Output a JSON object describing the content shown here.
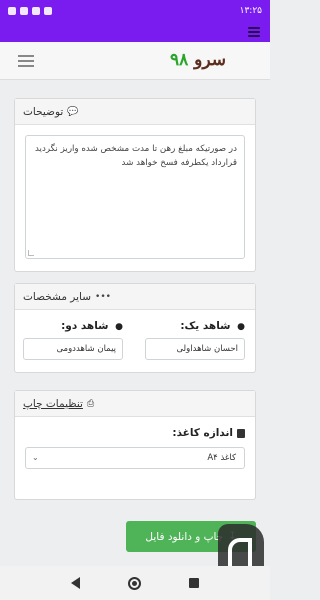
{
  "status_bar": {
    "time": "۱۳:۲۵",
    "icons": [
      "battery-icon",
      "signal-icon",
      "wifi-icon",
      "notification-icon"
    ]
  },
  "app_bar": {
    "logo_text": "سرو",
    "logo_number": "۹۸",
    "menu_icon": "hamburger-icon"
  },
  "notes": {
    "title": "توضیحات",
    "icon": "comment-icon",
    "text": "در صورتیکه مبلغ رهن تا مدت مشخص شده واریز نگردید قرارداد یکطرفه فسخ خواهد شد"
  },
  "other_specs": {
    "title": "سایر مشخصات",
    "icon": "ellipsis-icon",
    "witness_one_label": "شاهد یک:",
    "witness_one_value": "احسان شاهداولی",
    "witness_two_label": "شاهد دو:",
    "witness_two_value": "پیمان شاهددومی"
  },
  "print_settings": {
    "title": "تنظیمات چاپ",
    "icon": "printer-icon",
    "paper_size_label": "اندازه کاغذ:",
    "paper_size_value": "کاغذ A۴"
  },
  "download_button": {
    "label": "چاپ و دانلود فایل",
    "icon": "download-icon"
  },
  "colors": {
    "accent": "#7a1cf0",
    "success": "#4fb358",
    "logo_brown": "#5b2d1e",
    "logo_green": "#2aa52a"
  }
}
